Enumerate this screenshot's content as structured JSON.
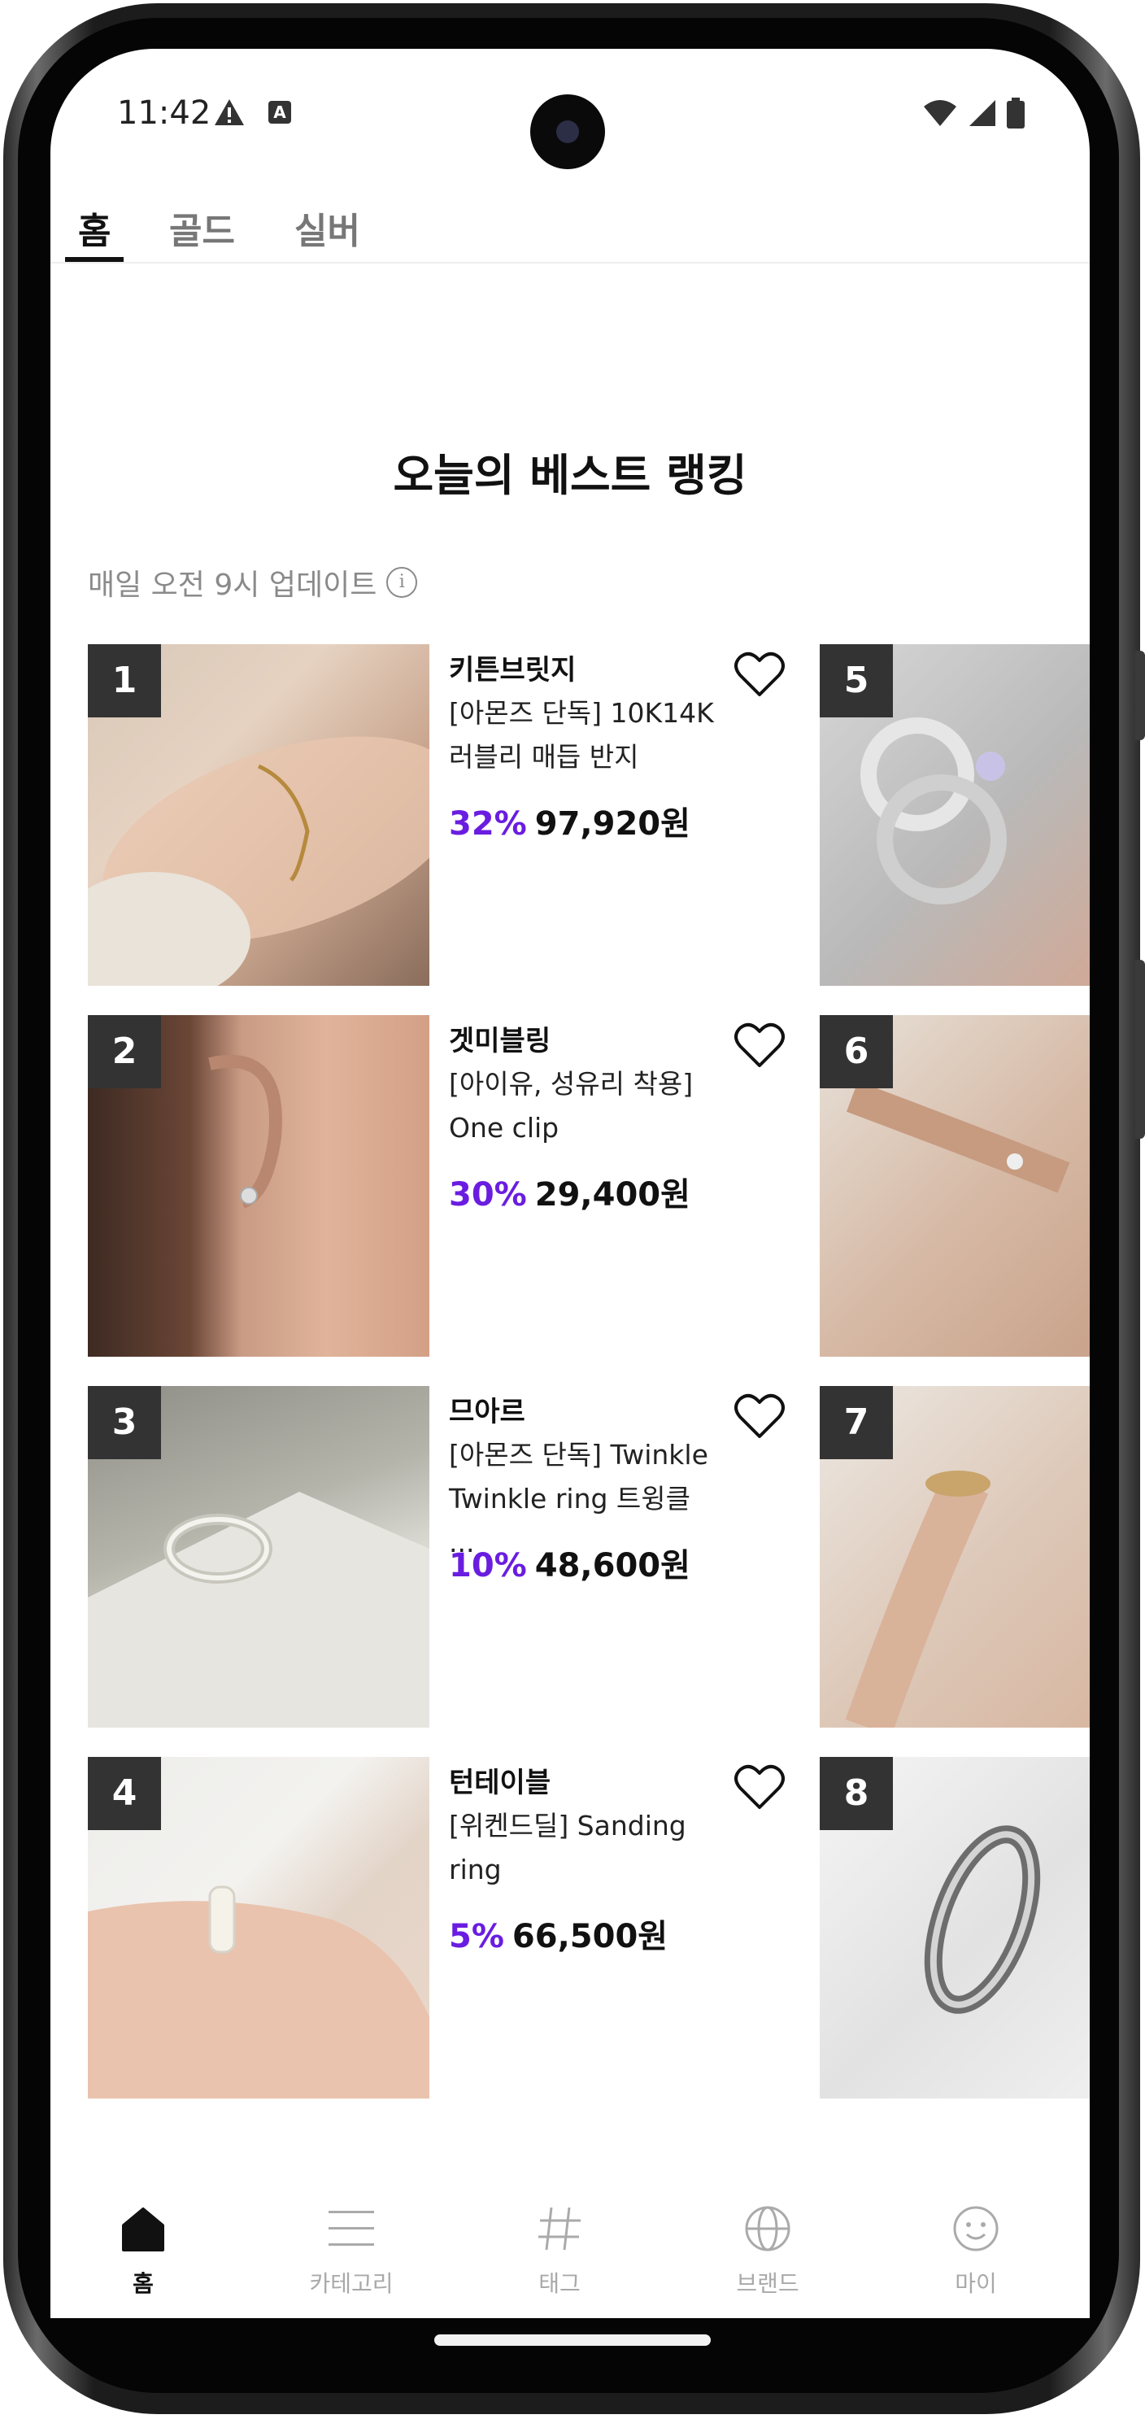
{
  "status_bar": {
    "time": "11:42"
  },
  "tabs": [
    {
      "label": "홈",
      "active": true
    },
    {
      "label": "골드",
      "active": false
    },
    {
      "label": "실버",
      "active": false
    }
  ],
  "section": {
    "title": "오늘의 베스트 랭킹",
    "subtitle": "매일 오전 9시 업데이트",
    "info_icon": "i"
  },
  "products": [
    {
      "rank": "1",
      "brand": "키튼브릿지",
      "name_line1": "[아몬즈 단독] 10K14K",
      "name_line2": "러블리 매듭 반지",
      "discount": "32%",
      "price": "97,920원"
    },
    {
      "rank": "2",
      "brand": "겟미블링",
      "name_line1": "[아이유, 성유리 착용]",
      "name_line2": "One clip",
      "discount": "30%",
      "price": "29,400원"
    },
    {
      "rank": "3",
      "brand": "므아르",
      "name_line1": "[아몬즈 단독] Twinkle",
      "name_line2": "Twinkle ring 트윙클 ...",
      "discount": "10%",
      "price": "48,600원"
    },
    {
      "rank": "4",
      "brand": "턴테이블",
      "name_line1": "[위켄드딜] Sanding",
      "name_line2": "ring",
      "discount": "5%",
      "price": "66,500원"
    }
  ],
  "side_products": [
    {
      "rank": "5"
    },
    {
      "rank": "6"
    },
    {
      "rank": "7"
    },
    {
      "rank": "8"
    }
  ],
  "bottom_nav": [
    {
      "label": "홈",
      "icon": "home-icon",
      "active": true
    },
    {
      "label": "카테고리",
      "icon": "menu-icon",
      "active": false
    },
    {
      "label": "태그",
      "icon": "hashtag-icon",
      "active": false
    },
    {
      "label": "브랜드",
      "icon": "globe-icon",
      "active": false
    },
    {
      "label": "마이",
      "icon": "smiley-icon",
      "active": false
    }
  ],
  "colors": {
    "discount": "#6a1de0",
    "rank_badge": "#333333"
  }
}
